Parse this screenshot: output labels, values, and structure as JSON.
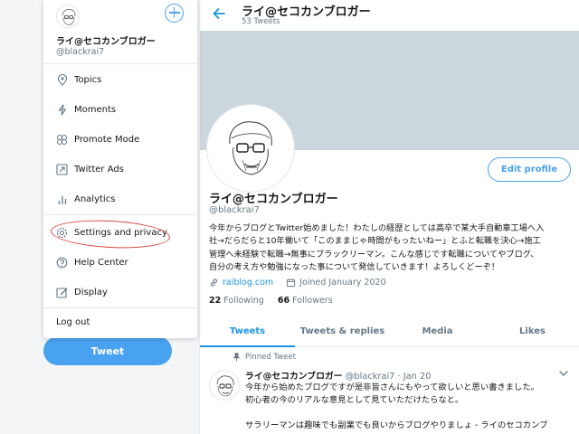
{
  "menu": {
    "name": "ライ@セコカンブロガー",
    "handle": "@blackrai7",
    "items": [
      {
        "label": "Topics",
        "icon": "topics-icon"
      },
      {
        "label": "Moments",
        "icon": "moments-icon"
      },
      {
        "label": "Promote Mode",
        "icon": "promote-mode-icon"
      },
      {
        "label": "Twitter Ads",
        "icon": "twitter-ads-icon"
      },
      {
        "label": "Analytics",
        "icon": "analytics-icon"
      },
      {
        "label": "Settings and privacy",
        "icon": "settings-icon"
      },
      {
        "label": "Help Center",
        "icon": "help-icon"
      },
      {
        "label": "Display",
        "icon": "display-icon"
      }
    ],
    "logout": "Log out"
  },
  "sidebar": {
    "tweet_button": "Tweet"
  },
  "header": {
    "name": "ライ@セコカンブロガー",
    "tweet_count": "53 Tweets"
  },
  "profile": {
    "edit_button": "Edit profile",
    "name": "ライ@セコカンブロガー",
    "handle": "@blackrai7",
    "bio_lines": [
      "今年からブログとTwitter始めました！わたしの経歴としては高卒で某大手自動車工場へ入",
      "社→だらだらと10年働いて「このままじゃ時間がもったいねー」とふと転職を決心→施工",
      "管理へ未経験で転職→無事にブラックリーマン。こんな感じです転職についてやブログ、",
      "自分の考え方や勉強になった事について発信していきます！よろしくどーぞ！"
    ],
    "website": "raiblog.com",
    "joined": "Joined January 2020",
    "following_count": "22",
    "following_label": "Following",
    "followers_count": "66",
    "followers_label": "Followers"
  },
  "tabs": [
    "Tweets",
    "Tweets & replies",
    "Media",
    "Likes"
  ],
  "pinned_tweet": {
    "label": "Pinned Tweet",
    "name": "ライ@セコカンブロガー",
    "handle": "@blackrai7",
    "date": "· Jan 20",
    "lines": [
      "今年から始めたブログですが是非皆さんにもやって欲しいと思い書きました。",
      "初心者の今のリアルな意見として見ていただけたらなと。",
      "",
      "サラリーマンは趣味でも副業でも良いからブログやりましょ - ライのセコカンブ"
    ]
  },
  "colors": {
    "accent": "#1b95e0",
    "button": "#49a2ef",
    "annotation": "#d9463f",
    "banner": "#ccd6dd"
  }
}
